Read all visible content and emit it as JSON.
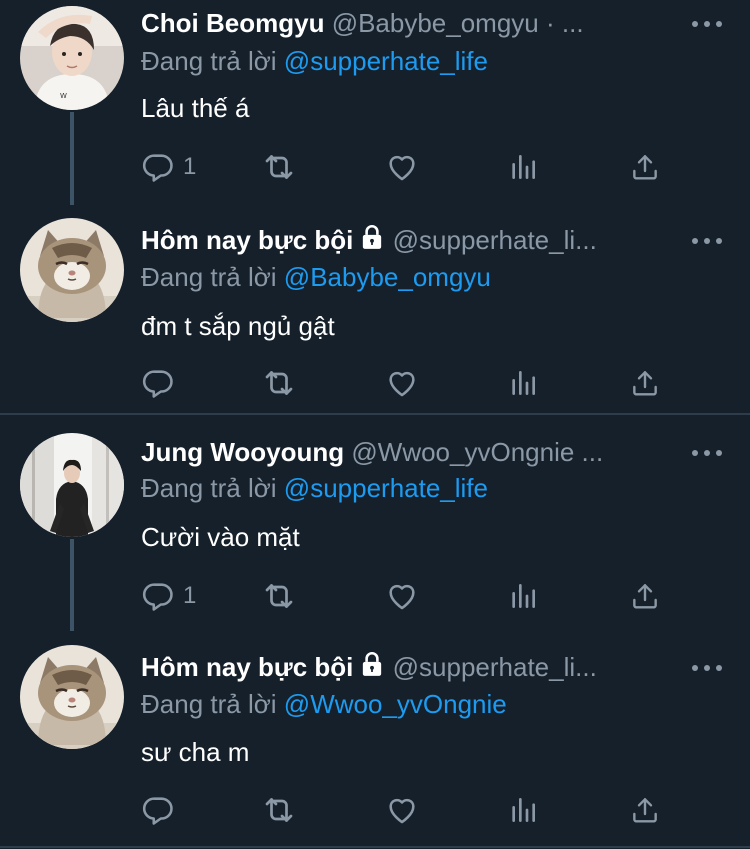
{
  "tweets": [
    {
      "name": "Choi Beomgyu",
      "handle": "@Babybe_omgyu · ...",
      "replying_label": "Đang trả lời",
      "replying_to": "@supperhate_life",
      "text": "Lâu thế á",
      "reply_count": "1",
      "locked": false,
      "avatar": "person-white-shirt"
    },
    {
      "name": "Hôm nay bực bội",
      "handle": "@supperhate_li...",
      "replying_label": "Đang trả lời",
      "replying_to": "@Babybe_omgyu",
      "text": "đm t sắp ngủ gật",
      "reply_count": "",
      "locked": true,
      "avatar": "grumpy-cat"
    },
    {
      "name": "Jung Wooyoung",
      "handle": "@Wwoo_yvOngnie ...",
      "replying_label": "Đang trả lời",
      "replying_to": "@supperhate_life",
      "text": "Cười vào mặt",
      "reply_count": "1",
      "locked": false,
      "avatar": "person-black-coat"
    },
    {
      "name": "Hôm nay bực bội",
      "handle": "@supperhate_li...",
      "replying_label": "Đang trả lời",
      "replying_to": "@Wwoo_yvOngnie",
      "text": "sư cha m",
      "reply_count": "",
      "locked": true,
      "avatar": "grumpy-cat"
    }
  ],
  "icons": [
    "reply-icon",
    "retweet-icon",
    "like-icon",
    "analytics-icon",
    "share-icon",
    "more-icon",
    "lock-icon"
  ],
  "colors": {
    "background": "#15202b",
    "text_primary": "#ffffff",
    "text_secondary": "#8b98a5",
    "mention": "#1d9bf0",
    "divider": "#2f3d4a"
  }
}
